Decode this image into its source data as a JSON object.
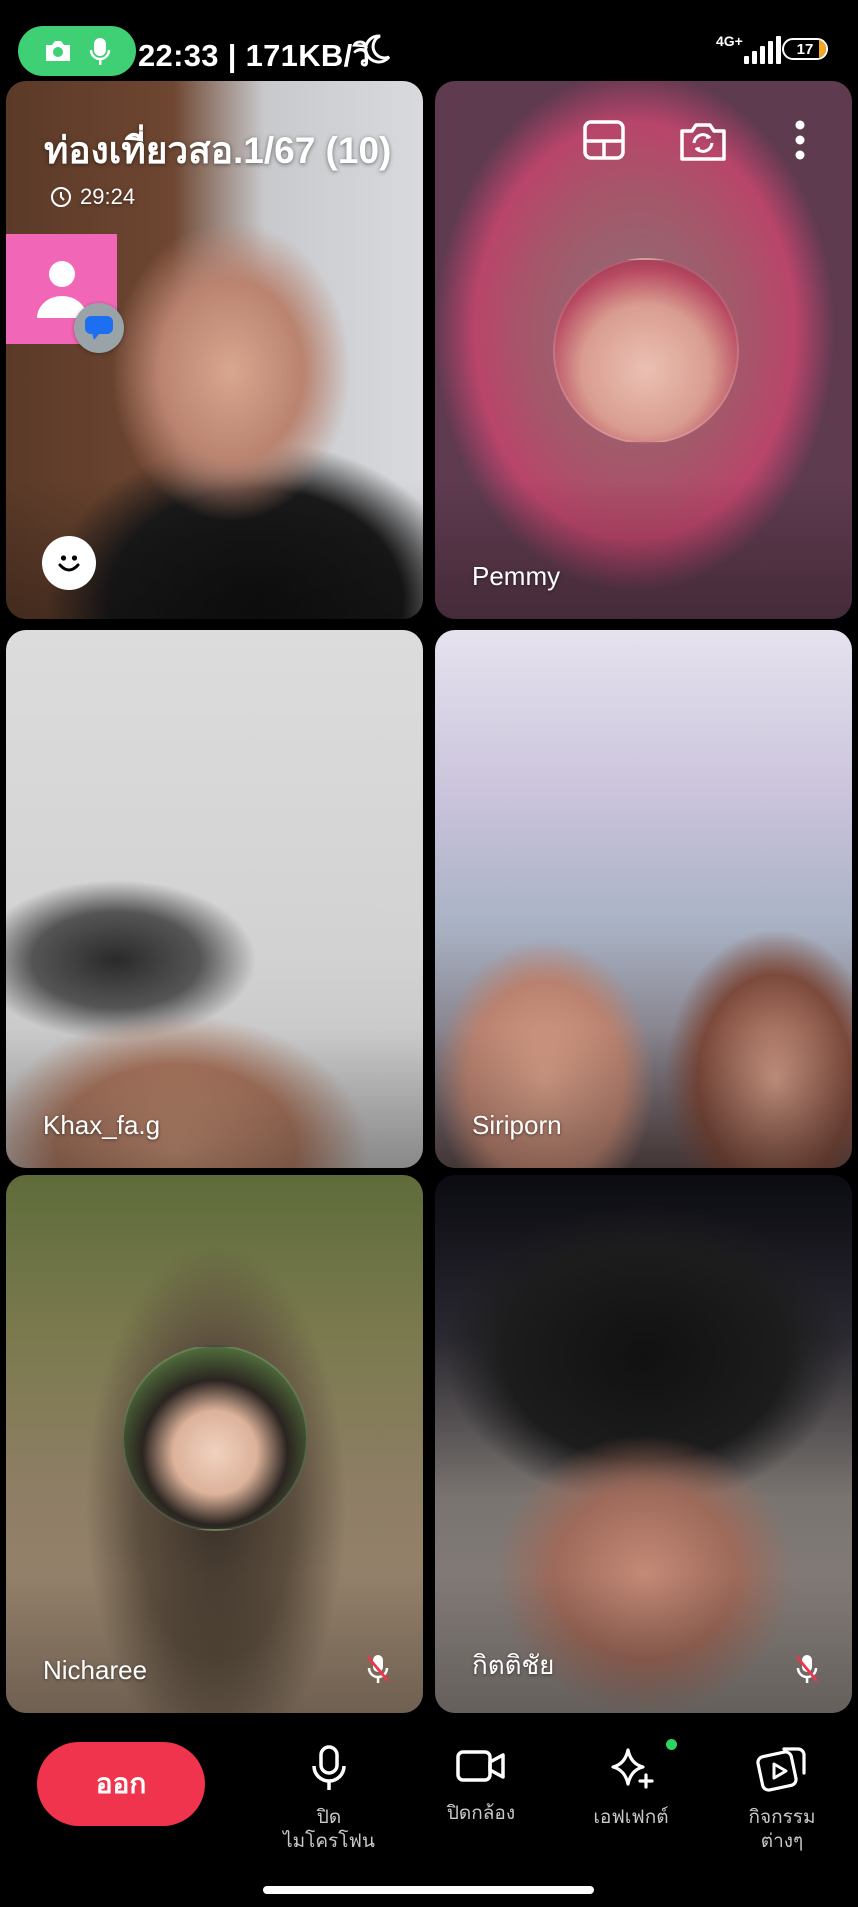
{
  "status_bar": {
    "text": "22:33 | 171KB/วิ",
    "network": "4G+",
    "battery": "17",
    "battery_level": 0.17,
    "colors": {
      "recording_pill": "#3fcf74",
      "battery_fill": "#f5a623"
    }
  },
  "call": {
    "title": "ท่องเที่ยวสอ.1/67 (10)",
    "timer": "29:24",
    "icons": [
      "layout-icon",
      "switch-camera-icon",
      "more-icon"
    ]
  },
  "participants": [
    {
      "name": "",
      "self_view": true
    },
    {
      "name": "Pemmy",
      "avatar": true
    },
    {
      "name": "Khax_fa.g"
    },
    {
      "name": "Siriporn"
    },
    {
      "name": "Nicharee",
      "avatar": true,
      "muted": true
    },
    {
      "name": "กิตติชัย",
      "muted": true
    }
  ],
  "controls": {
    "leave_label": "ออก",
    "mic_label": "ปิด\nไมโครโฟน",
    "camera_label": "ปิดกล้อง",
    "effects_label": "เอฟเฟกต์",
    "activities_label": "กิจกรรม\nต่างๆ",
    "colors": {
      "leave_button": "#f0344d",
      "effects_dot": "#2fd15f"
    }
  }
}
